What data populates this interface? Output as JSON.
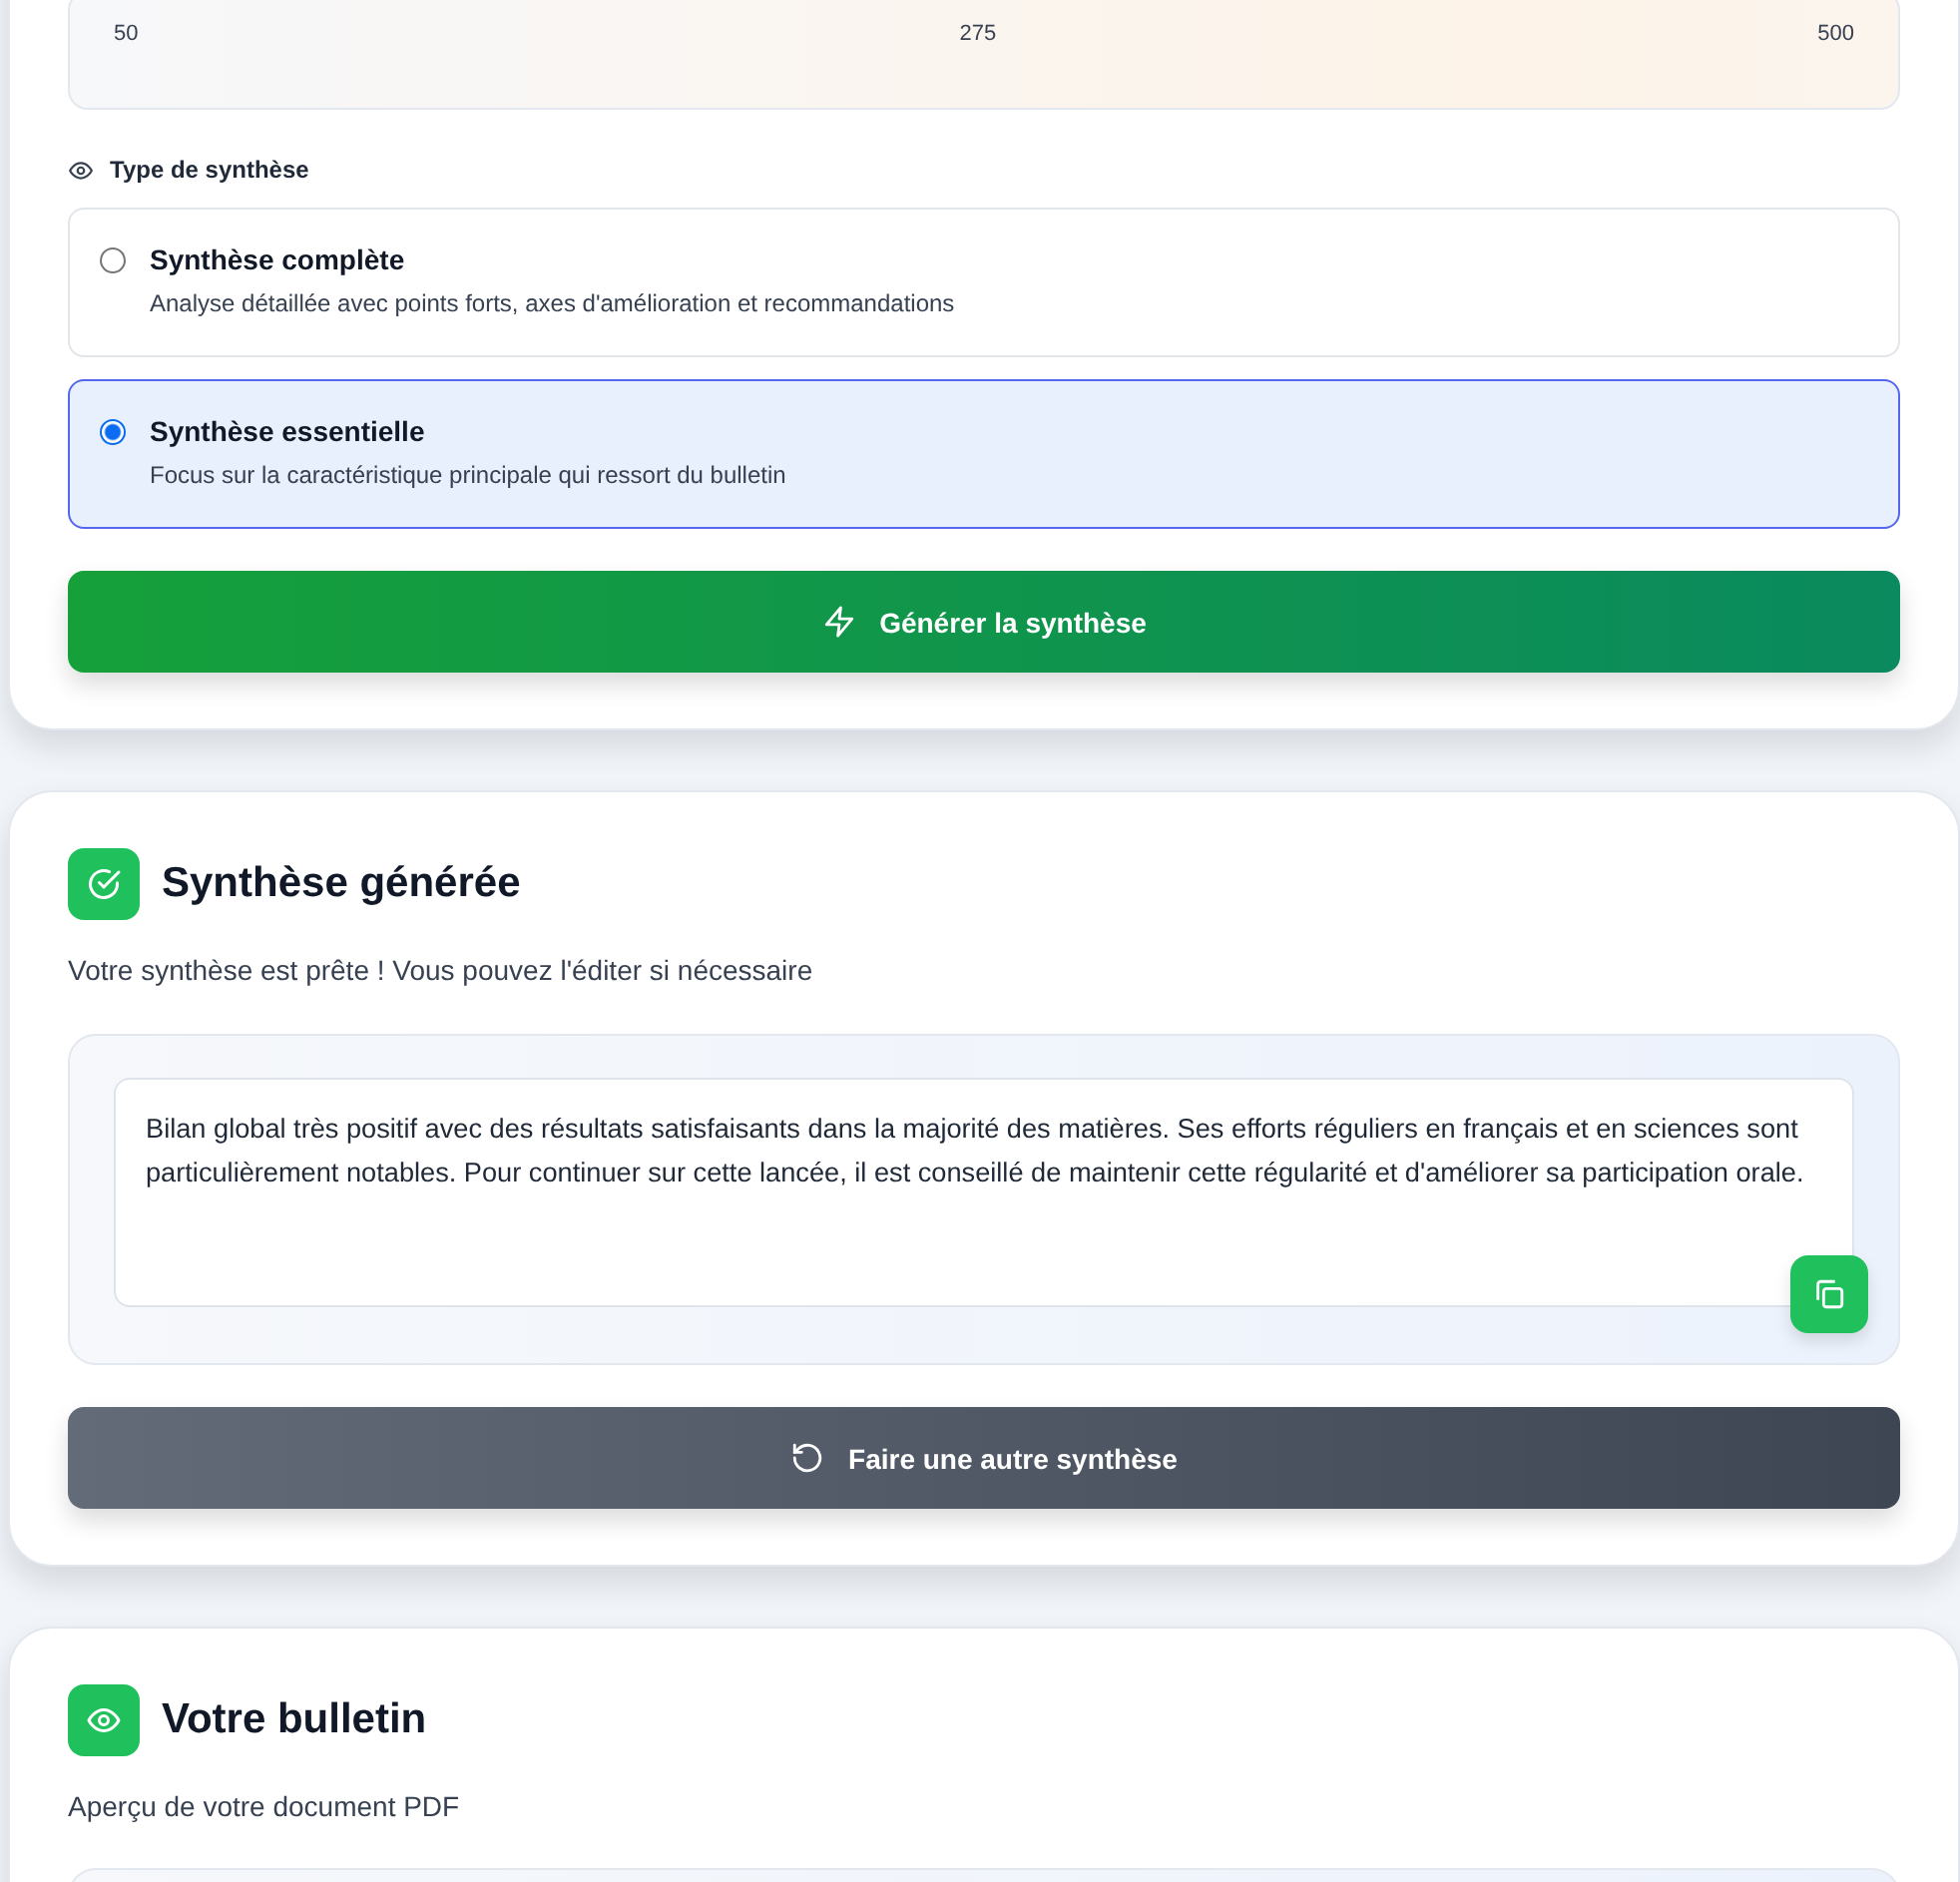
{
  "range": {
    "ticks": [
      "50",
      "275",
      "500"
    ]
  },
  "synthesis_type": {
    "label": "Type de synthèse",
    "options": [
      {
        "title": "Synthèse complète",
        "description": "Analyse détaillée avec points forts, axes d'amélioration et recommandations",
        "selected": false
      },
      {
        "title": "Synthèse essentielle",
        "description": "Focus sur la caractéristique principale qui ressort du bulletin",
        "selected": true
      }
    ]
  },
  "generate_button": {
    "label": "Générer la synthèse"
  },
  "result": {
    "title": "Synthèse générée",
    "subtitle": "Votre synthèse est prête ! Vous pouvez l'éditer si nécessaire",
    "text": "Bilan global très positif avec des résultats satisfaisants dans la majorité des matières. Ses efforts réguliers en français et en sciences sont particulièrement notables. Pour continuer sur cette lancée, il est conseillé de maintenir cette régularité et d'améliorer sa participation orale.",
    "regenerate_button": {
      "label": "Faire une autre synthèse"
    }
  },
  "bulletin": {
    "title": "Votre bulletin",
    "subtitle": "Aperçu de votre document PDF"
  }
}
